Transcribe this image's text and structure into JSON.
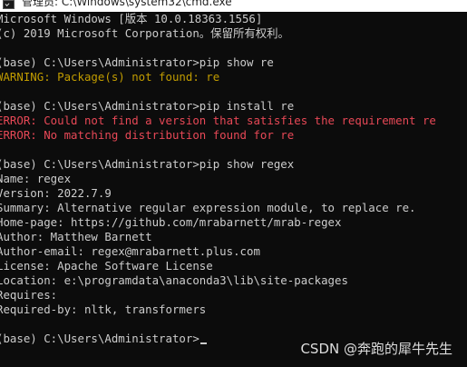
{
  "window": {
    "title": "管理员: C:\\Windows\\system32\\cmd.exe",
    "icon": "cmd-icon",
    "colors": {
      "background": "#0c0c0c",
      "text": "#cccccc",
      "warning": "#c19c00",
      "error": "#e74856",
      "titlebar": "#ffffff"
    }
  },
  "console": {
    "lines": [
      {
        "text": "Microsoft Windows [版本 10.0.18363.1556]",
        "kind": "normal"
      },
      {
        "text": "(c) 2019 Microsoft Corporation。保留所有权利。",
        "kind": "normal"
      },
      {
        "text": "",
        "kind": "normal"
      },
      {
        "text": "(base) C:\\Users\\Administrator>pip show re",
        "kind": "normal"
      },
      {
        "text": "WARNING: Package(s) not found: re",
        "kind": "warning"
      },
      {
        "text": "",
        "kind": "normal"
      },
      {
        "text": "(base) C:\\Users\\Administrator>pip install re",
        "kind": "normal"
      },
      {
        "text": "ERROR: Could not find a version that satisfies the requirement re",
        "kind": "error"
      },
      {
        "text": "ERROR: No matching distribution found for re",
        "kind": "error"
      },
      {
        "text": "",
        "kind": "normal"
      },
      {
        "text": "(base) C:\\Users\\Administrator>pip show regex",
        "kind": "normal"
      },
      {
        "text": "Name: regex",
        "kind": "normal"
      },
      {
        "text": "Version: 2022.7.9",
        "kind": "normal"
      },
      {
        "text": "Summary: Alternative regular expression module, to replace re.",
        "kind": "normal"
      },
      {
        "text": "Home-page: https://github.com/mrabarnett/mrab-regex",
        "kind": "normal"
      },
      {
        "text": "Author: Matthew Barnett",
        "kind": "normal"
      },
      {
        "text": "Author-email: regex@mrabarnett.plus.com",
        "kind": "normal"
      },
      {
        "text": "License: Apache Software License",
        "kind": "normal"
      },
      {
        "text": "Location: e:\\programdata\\anaconda3\\lib\\site-packages",
        "kind": "normal"
      },
      {
        "text": "Requires:",
        "kind": "normal"
      },
      {
        "text": "Required-by: nltk, transformers",
        "kind": "normal"
      },
      {
        "text": "",
        "kind": "normal"
      }
    ],
    "prompt": "(base) C:\\Users\\Administrator>"
  },
  "watermark": {
    "text": "CSDN @奔跑的犀牛先生"
  }
}
